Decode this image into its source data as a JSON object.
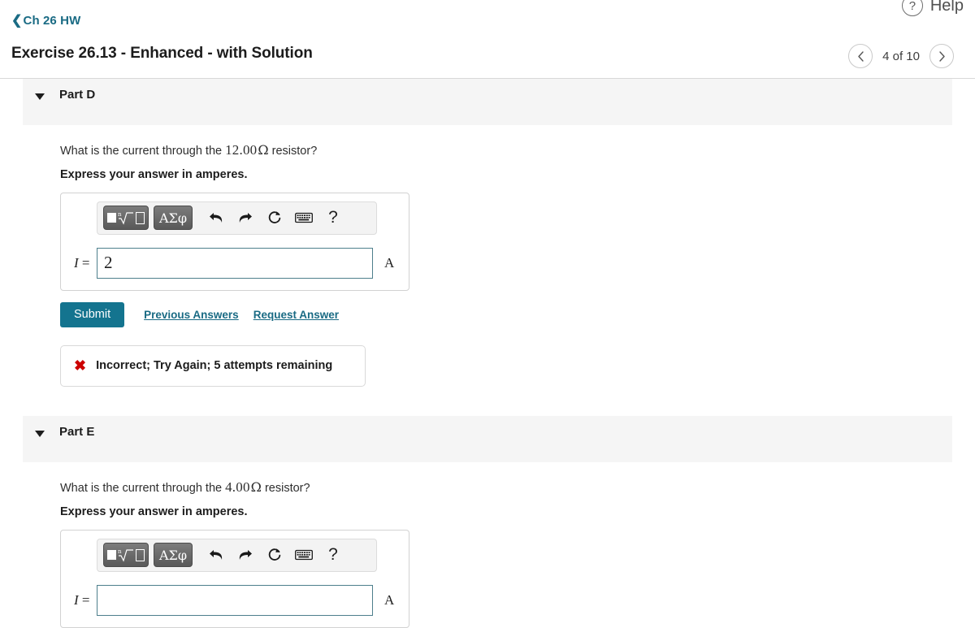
{
  "header": {
    "breadcrumb_label": "Ch 26 HW",
    "breadcrumb_chevron": "back-chevron-icon",
    "exercise_title": "Exercise 26.13 - Enhanced - with Solution",
    "help_label": "Help",
    "help_icon_glyph": "?",
    "pager": {
      "prev_glyph": "‹",
      "next_glyph": "›",
      "position_label": "4 of 10"
    }
  },
  "toolbar": {
    "template_button_name": "math-template-button",
    "greek_button_label": "ΑΣφ",
    "undo_label": "undo-icon",
    "redo_label": "redo-icon",
    "reset_label": "reset-icon",
    "keyboard_label": "keyboard-icon",
    "help_glyph": "?"
  },
  "parts": [
    {
      "id": "part-d",
      "title": "Part D",
      "question_prefix": "What is the current through the ",
      "question_value": "12.00",
      "question_unit": "Ω",
      "question_suffix": " resistor?",
      "instruction": "Express your answer in amperes.",
      "variable_label": "I",
      "equals": "=",
      "answer_value": "2",
      "answer_placeholder": "",
      "unit_label": "A",
      "submit_label": "Submit",
      "previous_answers_label": "Previous Answers",
      "request_answer_label": "Request Answer",
      "feedback": {
        "icon": "✖",
        "text": "Incorrect; Try Again; 5 attempts remaining"
      }
    },
    {
      "id": "part-e",
      "title": "Part E",
      "question_prefix": "What is the current through the ",
      "question_value": "4.00",
      "question_unit": "Ω",
      "question_suffix": " resistor?",
      "instruction": "Express your answer in amperes.",
      "variable_label": "I",
      "equals": "=",
      "answer_value": "",
      "answer_placeholder": "",
      "unit_label": "A"
    }
  ],
  "colors": {
    "link": "#1a6b84",
    "submit_bg": "#14748f",
    "error": "#cc0000",
    "band_bg": "#f5f5f5",
    "input_border": "#4d7f8c"
  }
}
